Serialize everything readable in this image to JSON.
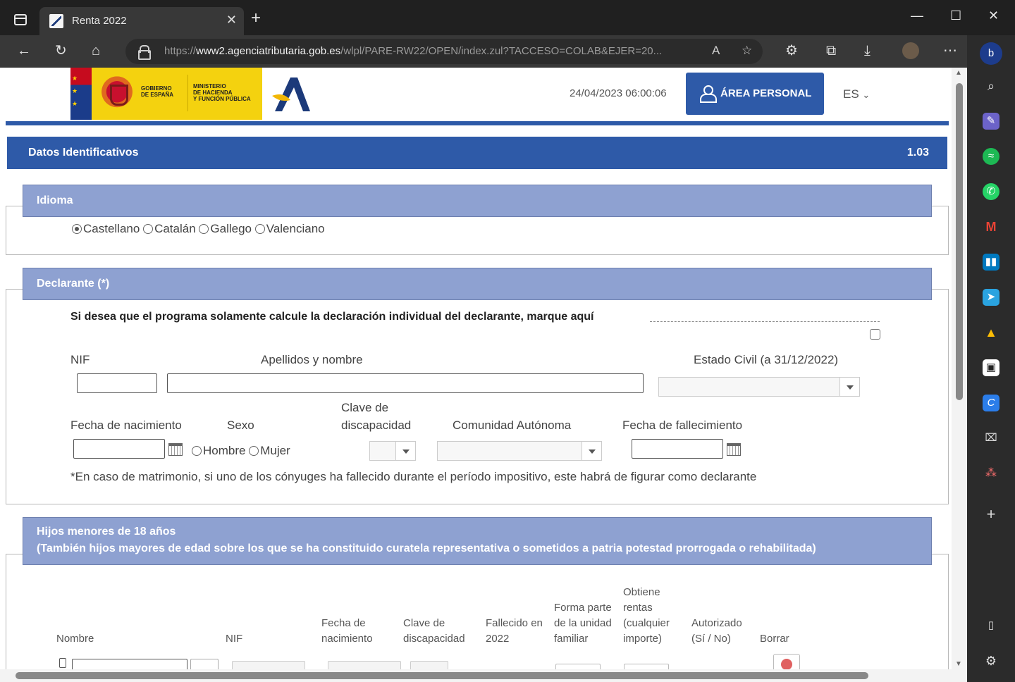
{
  "browser": {
    "tab_title": "Renta 2022",
    "tab_close": "✕",
    "new_tab": "+",
    "url_prefix": "https://",
    "url_domain": "www2.agenciatributaria.gob.es",
    "url_path": "/wlpl/PARE-RW22/OPEN/index.zul?TACCESO=COLAB&EJER=20...",
    "read_aloud": "A",
    "minimize": "—",
    "maximize": "☐",
    "close": "✕"
  },
  "header": {
    "gov_line1": "GOBIERNO",
    "gov_line2": "DE ESPAÑA",
    "min_line1": "MINISTERIO",
    "min_line2": "DE HACIENDA",
    "min_line3": "Y FUNCIÓN PÚBLICA",
    "datetime": "24/04/2023 06:00:06",
    "area_personal": "ÁREA PERSONAL",
    "language": "ES"
  },
  "section": {
    "title": "Datos Identificativos",
    "version": "1.03"
  },
  "idioma": {
    "title": "Idioma",
    "options": [
      "Castellano",
      "Catalán",
      "Gallego",
      "Valenciano"
    ],
    "selected": "Castellano"
  },
  "declarante": {
    "title": "Declarante (*)",
    "individual_note": "Si desea que el programa solamente calcule la declaración individual del declarante, marque aquí",
    "nif_label": "NIF",
    "nombre_label": "Apellidos y nombre",
    "estado_civil_label": "Estado Civil (a 31/12/2022)",
    "fecha_nac_label": "Fecha de nacimiento",
    "sexo_label": "Sexo",
    "sexo_options": [
      "Hombre",
      "Mujer"
    ],
    "clave_label_1": "Clave de",
    "clave_label_2": "discapacidad",
    "comunidad_label": "Comunidad Autónoma",
    "fecha_fall_label": "Fecha de fallecimiento",
    "footnote": "*En caso de matrimonio, si uno de los cónyuges ha fallecido durante el período impositivo, este habrá de figurar como declarante"
  },
  "hijos": {
    "title_1": "Hijos menores de 18 años",
    "title_2": "(También hijos mayores de edad sobre los que se ha constituido curatela representativa o sometidos a patria potestad prorrogada o rehabilitada)",
    "columns": {
      "nombre": "Nombre",
      "nif": "NIF",
      "fecha_1": "Fecha de",
      "fecha_2": "nacimiento",
      "clave_1": "Clave de",
      "clave_2": "discapacidad",
      "fallecido_1": "Fallecido en",
      "fallecido_2": "2022",
      "forma_1": "Forma parte",
      "forma_2": "de la unidad",
      "forma_3": "familiar",
      "obtiene_1": "Obtiene",
      "obtiene_2": "rentas",
      "obtiene_3": "(cualquier",
      "obtiene_4": "importe)",
      "autorizado_1": "Autorizado",
      "autorizado_2": "(Sí / No)",
      "borrar": "Borrar"
    }
  },
  "colors": {
    "brand_blue": "#2e5aa8",
    "panel_header": "#8ea1d1",
    "gov_yellow": "#f4d20f"
  }
}
